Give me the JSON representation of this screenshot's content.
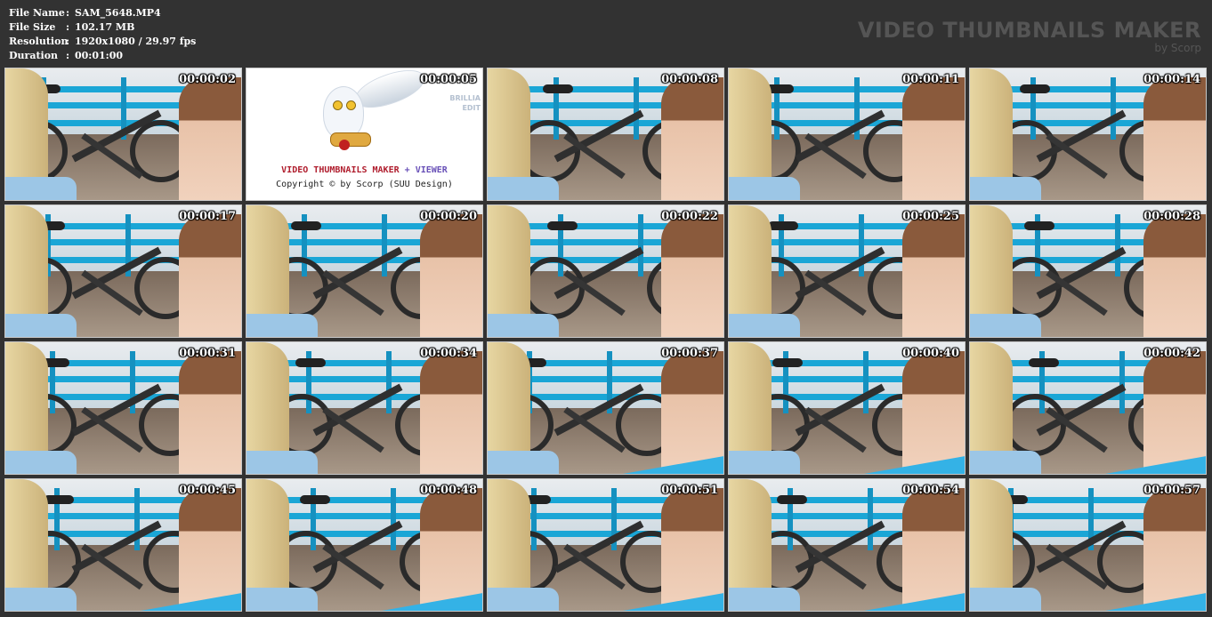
{
  "info": {
    "rows": [
      {
        "label": "File Name",
        "sep": ":",
        "value": "SAM_5648.MP4"
      },
      {
        "label": "File Size",
        "sep": ":",
        "value": "102.17 MB"
      },
      {
        "label": "Resolution",
        "sep": ":",
        "value": "1920x1080 / 29.97 fps"
      },
      {
        "label": "Duration",
        "sep": ":",
        "value": "00:01:00"
      }
    ]
  },
  "brand": {
    "title": "VIDEO THUMBNAILS MAKER",
    "subtitle": "by Scorp"
  },
  "logo": {
    "title_part1": "VIDEO THUMBNAILS MAKER",
    "title_part2": "+ VIEWER",
    "copyright": "Copyright © by Scorp (SUU Design)",
    "faint_line1": "BRILLIA",
    "faint_line2": "EDIT"
  },
  "thumbnails": [
    {
      "time": "00:00:02"
    },
    {
      "time": "00:00:05"
    },
    {
      "time": "00:00:08"
    },
    {
      "time": "00:00:11"
    },
    {
      "time": "00:00:14"
    },
    {
      "time": "00:00:17"
    },
    {
      "time": "00:00:20"
    },
    {
      "time": "00:00:22"
    },
    {
      "time": "00:00:25"
    },
    {
      "time": "00:00:28"
    },
    {
      "time": "00:00:31"
    },
    {
      "time": "00:00:34"
    },
    {
      "time": "00:00:37"
    },
    {
      "time": "00:00:40"
    },
    {
      "time": "00:00:42"
    },
    {
      "time": "00:00:45"
    },
    {
      "time": "00:00:48"
    },
    {
      "time": "00:00:51"
    },
    {
      "time": "00:00:54"
    },
    {
      "time": "00:00:57"
    }
  ],
  "colors": {
    "background": "#323232",
    "rail": "#1aa6d6",
    "timestamp": "#ffffff"
  }
}
